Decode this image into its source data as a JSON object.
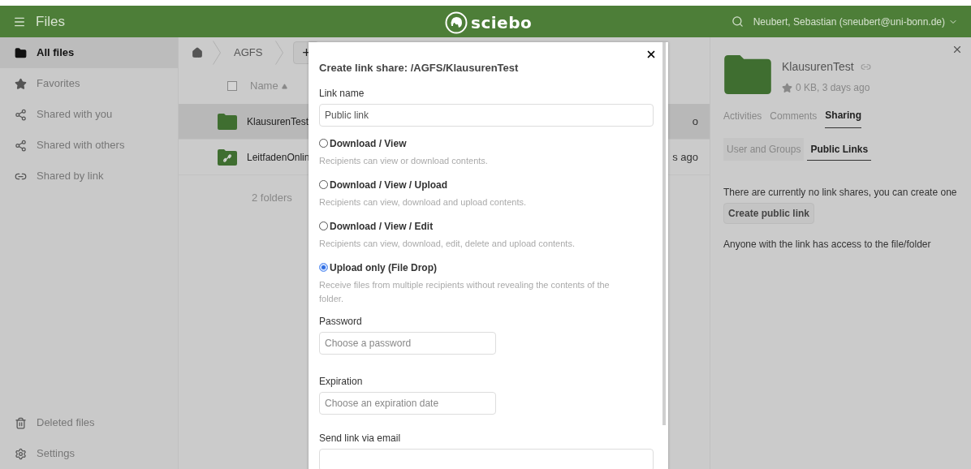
{
  "header": {
    "title": "Files",
    "logo": "sciebo",
    "user": "Neubert, Sebastian (sneubert@uni-bonn.de)"
  },
  "sidebar": {
    "items": [
      {
        "label": "All files",
        "selected": true
      },
      {
        "label": "Favorites",
        "selected": false
      },
      {
        "label": "Shared with you",
        "selected": false
      },
      {
        "label": "Shared with others",
        "selected": false
      },
      {
        "label": "Shared by link",
        "selected": false
      }
    ],
    "bottom_items": [
      {
        "label": "Deleted files"
      },
      {
        "label": "Settings"
      }
    ]
  },
  "breadcrumb": {
    "items": [
      "AGFS"
    ],
    "new_button": "+"
  },
  "file_list": {
    "select_all": {
      "checked": false
    },
    "name_column": "Name",
    "rows": [
      {
        "name": "KlausurenTest",
        "kind": "folder",
        "selected": true,
        "column_3": "o"
      },
      {
        "name": "LeitfadenOnlin",
        "kind": "shared-folder",
        "selected": false,
        "column_3": "s ago"
      }
    ],
    "summary": "2 folders"
  },
  "details": {
    "name": "KlausurenTest",
    "meta": "0 KB, 3 days ago",
    "tabs": [
      {
        "label": "Activities",
        "selected": false
      },
      {
        "label": "Comments",
        "selected": false
      },
      {
        "label": "Sharing",
        "selected": true
      }
    ],
    "subtabs": [
      {
        "label": "User and Groups",
        "selected": false
      },
      {
        "label": "Public Links",
        "selected": true
      }
    ],
    "message": "There are currently no link shares, you can create one",
    "button": "Create public link",
    "note": "Anyone with the link has access to the file/folder"
  },
  "modal": {
    "title": "Create link share: /AGFS/KlausurenTest",
    "link_name": {
      "label": "Link name",
      "value": "Public link"
    },
    "options": [
      {
        "title": "Download / View",
        "description": "Recipients can view or download contents.",
        "selected": false
      },
      {
        "title": "Download / View / Upload",
        "description": "Recipients can view, download and upload contents.",
        "selected": false
      },
      {
        "title": "Download / View / Edit",
        "description": "Recipients can view, download, edit, delete and upload contents.",
        "selected": false
      },
      {
        "title": "Upload only (File Drop)",
        "description": "Receive files from multiple recipients without revealing the contents of the folder.",
        "selected": true
      }
    ],
    "password": {
      "label": "Password",
      "placeholder": "Choose a password"
    },
    "expiration": {
      "label": "Expiration",
      "placeholder": "Choose an expiration date"
    },
    "email": {
      "label": "Send link via email"
    }
  }
}
